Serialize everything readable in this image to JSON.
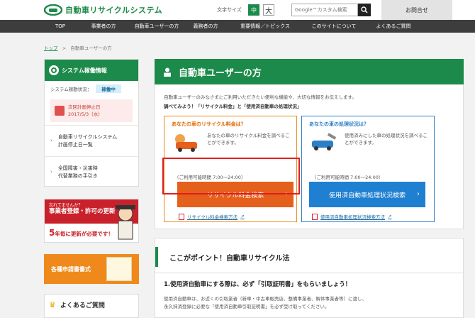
{
  "header": {
    "site_name": "自動車リサイクルシステム",
    "font_size_label": "文字サイズ",
    "font_mid": "中",
    "font_large": "大",
    "search_placeholder": "Google™カスタム検索",
    "contact": "お問合せ"
  },
  "nav": [
    "TOP",
    "事業者の方",
    "自動車ユーザーの方",
    "義務者の方",
    "重要情報／トピックス",
    "このサイトについて",
    "よくあるご質問"
  ],
  "breadcrumb": {
    "home": "トップ",
    "sep": ">",
    "current": "自動車ユーザーの方"
  },
  "sidebar": {
    "system_title": "システム稼働情報",
    "status_label": "システム稼動状況：",
    "status_value": "稼働中",
    "schedule_line1": "次回計画停止日",
    "schedule_line2": "2017/5/3（水）",
    "links": [
      {
        "line1": "自動車リサイクルシステム",
        "line2": "計画停止日一覧"
      },
      {
        "line1": "全国障害・災害時",
        "line2": "代替業務の手引き"
      }
    ],
    "renew_small": "忘れてませんか？",
    "renew_title": "事業者登録・許可の更新",
    "renew_num": "5",
    "renew_text": "年毎に更新が必要です！",
    "forms_label": "各種申請書書式",
    "faq_label": "よくあるご質問"
  },
  "main": {
    "title": "自動車ユーザーの方",
    "intro": "自動車ユーザーのみなさまにご利用いただきたい便利な機能や、大切な情報をお伝えします。",
    "intro_sub": "調べてみよう！「リサイクル料金」と「使用済自動車の処理状況」",
    "card_recycle": {
      "question": "あなたの車のリサイクル料金は？",
      "desc": "あなたの車のリサイクル料金を調べることができます。",
      "hours": "（ご利用可能時間 7:00～24:00）",
      "button": "リサイクル料金検索",
      "link": "リサイクル料金検索方法"
    },
    "card_status": {
      "question": "あなたの車の処理状況は？",
      "desc": "使用済みにした車の処理状況を調べることができます。",
      "hours": "（ご利用可能時間 7:00～24:00）",
      "button": "使用済自動車処理状況検索",
      "link": "使用済自動車処理状況検索方法"
    },
    "point_title": "ここがポイント！自動車リサイクル法",
    "point_sub": "1.使用済自動車にする際は、必ず「引取証明書」をもらいましょう！",
    "point_text1": "使用済自動車は、お近くの引取業者（新車・中古車販売店、整備事業者、解体事業者等）に渡し、",
    "point_text2": "永久抹消登録に必要な「使用済自動車引取証明書」を必ず受け取ってください。"
  },
  "colors": {
    "brand": "#1c8a4a",
    "orange": "#e4601c",
    "blue": "#1f7fd1",
    "highlight": "#e01e1e"
  }
}
